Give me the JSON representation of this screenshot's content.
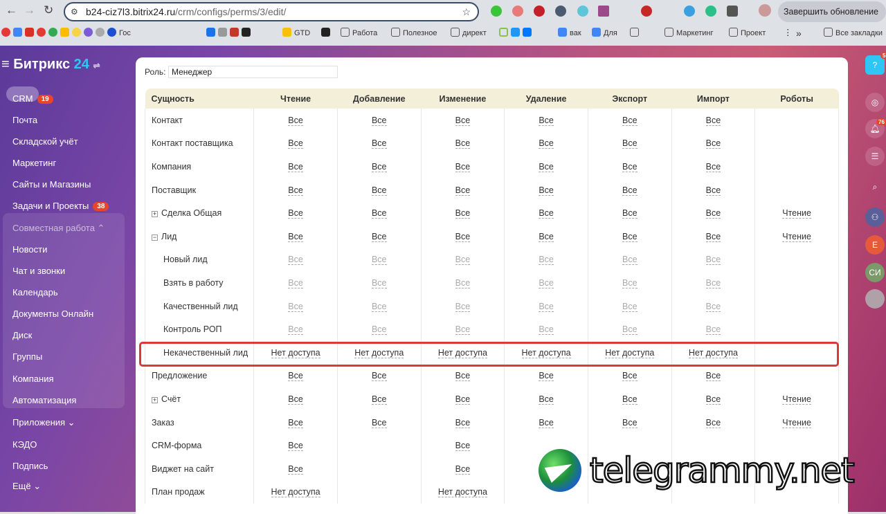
{
  "browser": {
    "url_host": "b24-ciz7l3.bitrix24.ru",
    "url_path": "/crm/configs/perms/3/edit/",
    "update_button": "Завершить обновление",
    "bookmarks": [
      "Гос",
      "GTD",
      "Работа",
      "Полезное",
      "директ",
      "вак",
      "Для",
      "Маркетинг",
      "Проект"
    ],
    "more": "»",
    "all_bookmarks": "Все закладки"
  },
  "sidebar": {
    "logo_text": "Битрикс",
    "logo_num": "24",
    "items": [
      {
        "label": "CRM",
        "badge": "19"
      },
      {
        "label": "Почта"
      },
      {
        "label": "Складской учёт"
      },
      {
        "label": "Маркетинг"
      },
      {
        "label": "Сайты и Магазины"
      },
      {
        "label": "Задачи и Проекты",
        "badge": "38"
      },
      {
        "label": "Совместная работа ⌃"
      },
      {
        "label": "Новости"
      },
      {
        "label": "Чат и звонки"
      },
      {
        "label": "Календарь"
      },
      {
        "label": "Документы Онлайн"
      },
      {
        "label": "Диск"
      },
      {
        "label": "Группы"
      },
      {
        "label": "Компания"
      },
      {
        "label": "Автоматизация"
      },
      {
        "label": "Приложения ⌄"
      },
      {
        "label": "КЭДО"
      },
      {
        "label": "Подпись"
      },
      {
        "label": "Ещё ⌄"
      }
    ]
  },
  "rightbar": {
    "help_badge": "5",
    "notifications_badge": "76",
    "avatars": [
      "Е",
      "СИ"
    ]
  },
  "form": {
    "role_label": "Роль:",
    "role_value": "Менеджер"
  },
  "table": {
    "headers": [
      "Сущность",
      "Чтение",
      "Добавление",
      "Изменение",
      "Удаление",
      "Экспорт",
      "Импорт",
      "Роботы"
    ],
    "rows": [
      {
        "name": "Контакт",
        "cells": [
          "Все",
          "Все",
          "Все",
          "Все",
          "Все",
          "Все",
          ""
        ]
      },
      {
        "name": "Контакт поставщика",
        "cells": [
          "Все",
          "Все",
          "Все",
          "Все",
          "Все",
          "Все",
          ""
        ]
      },
      {
        "name": "Компания",
        "cells": [
          "Все",
          "Все",
          "Все",
          "Все",
          "Все",
          "Все",
          ""
        ]
      },
      {
        "name": "Поставщик",
        "cells": [
          "Все",
          "Все",
          "Все",
          "Все",
          "Все",
          "Все",
          ""
        ]
      },
      {
        "name": "Сделка Общая",
        "expander": "+",
        "cells": [
          "Все",
          "Все",
          "Все",
          "Все",
          "Все",
          "Все",
          "Чтение"
        ]
      },
      {
        "name": "Лид",
        "expander": "−",
        "cells": [
          "Все",
          "Все",
          "Все",
          "Все",
          "Все",
          "Все",
          "Чтение"
        ]
      },
      {
        "name": "Новый лид",
        "level": 1,
        "muted": true,
        "cells": [
          "Все",
          "Все",
          "Все",
          "Все",
          "Все",
          "Все",
          ""
        ]
      },
      {
        "name": "Взять в работу",
        "level": 1,
        "muted": true,
        "cells": [
          "Все",
          "Все",
          "Все",
          "Все",
          "Все",
          "Все",
          ""
        ]
      },
      {
        "name": "Качественный лид",
        "level": 1,
        "muted": true,
        "cells": [
          "Все",
          "Все",
          "Все",
          "Все",
          "Все",
          "Все",
          ""
        ]
      },
      {
        "name": "Контроль РОП",
        "level": 1,
        "muted": true,
        "cells": [
          "Все",
          "Все",
          "Все",
          "Все",
          "Все",
          "Все",
          ""
        ]
      },
      {
        "name": "Некачественный лид",
        "level": 1,
        "highlighted": true,
        "cells": [
          "Нет доступа",
          "Нет доступа",
          "Нет доступа",
          "Нет доступа",
          "Нет доступа",
          "Нет доступа",
          ""
        ]
      },
      {
        "name": "Предложение",
        "cells": [
          "Все",
          "Все",
          "Все",
          "Все",
          "Все",
          "Все",
          ""
        ]
      },
      {
        "name": "Счёт",
        "expander": "+",
        "cells": [
          "Все",
          "Все",
          "Все",
          "Все",
          "Все",
          "Все",
          "Чтение"
        ]
      },
      {
        "name": "Заказ",
        "cells": [
          "Все",
          "Все",
          "Все",
          "Все",
          "Все",
          "Все",
          "Чтение"
        ]
      },
      {
        "name": "CRM-форма",
        "cells": [
          "Все",
          "",
          "Все",
          "",
          "",
          "",
          ""
        ]
      },
      {
        "name": "Виджет на сайт",
        "cells": [
          "Все",
          "",
          "Все",
          "",
          "",
          "",
          ""
        ]
      },
      {
        "name": "План продаж",
        "cells": [
          "Нет доступа",
          "",
          "Нет доступа",
          "",
          "",
          "",
          ""
        ]
      }
    ]
  },
  "watermark": {
    "text": "telegrammy.net"
  }
}
